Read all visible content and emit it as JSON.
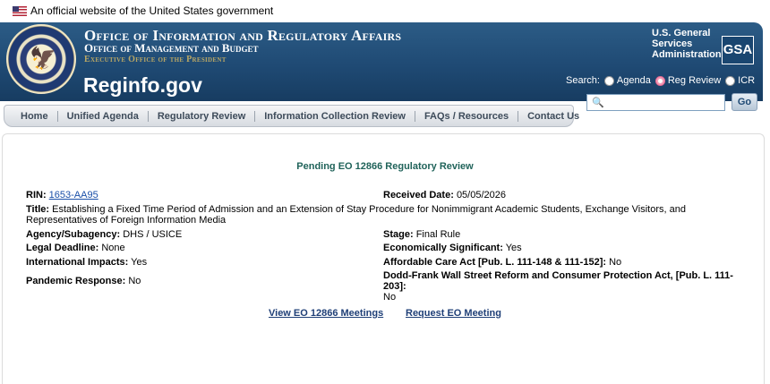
{
  "gov_banner": {
    "text": "An official website of the United States government"
  },
  "header": {
    "office_title": "Office of Information and Regulatory Affairs",
    "omb_title": "Office of Management and Budget",
    "eop_title": "Executive Office of the President",
    "site_name": "Reginfo.gov",
    "gsa_text": "U.S. General Services Administration",
    "gsa_logo": "GSA"
  },
  "search": {
    "label": "Search:",
    "options": [
      "Agenda",
      "Reg Review",
      "ICR"
    ],
    "selected": "Reg Review",
    "value": "",
    "go_label": "Go"
  },
  "nav": {
    "items": [
      "Home",
      "Unified Agenda",
      "Regulatory Review",
      "Information Collection Review",
      "FAQs / Resources",
      "Contact Us"
    ]
  },
  "review": {
    "title": "Pending EO 12866 Regulatory Review",
    "rin_label": "RIN:",
    "rin_value": "1653-AA95",
    "received_label": "Received Date:",
    "received_value": "05/05/2026",
    "title_label": "Title:",
    "title_value": "Establishing a Fixed Time Period of Admission and an Extension of Stay Procedure for Nonimmigrant Academic Students, Exchange Visitors, and Representatives of Foreign Information Media",
    "agency_label": "Agency/Subagency:",
    "agency_value": "DHS / USICE",
    "stage_label": "Stage:",
    "stage_value": "Final Rule",
    "legal_label": "Legal Deadline:",
    "legal_value": "None",
    "econ_label": "Economically Significant:",
    "econ_value": "Yes",
    "intl_label": "International Impacts:",
    "intl_value": "Yes",
    "aca_label": "Affordable Care Act [Pub. L. 111-148 & 111-152]:",
    "aca_value": "No",
    "dodd_label": "Dodd-Frank Wall Street Reform and Consumer Protection Act, [Pub. L. 111-203]:",
    "dodd_value": "No",
    "pandemic_label": "Pandemic Response:",
    "pandemic_value": "No"
  },
  "links": {
    "meetings": "View EO 12866 Meetings",
    "request": "Request EO Meeting"
  }
}
